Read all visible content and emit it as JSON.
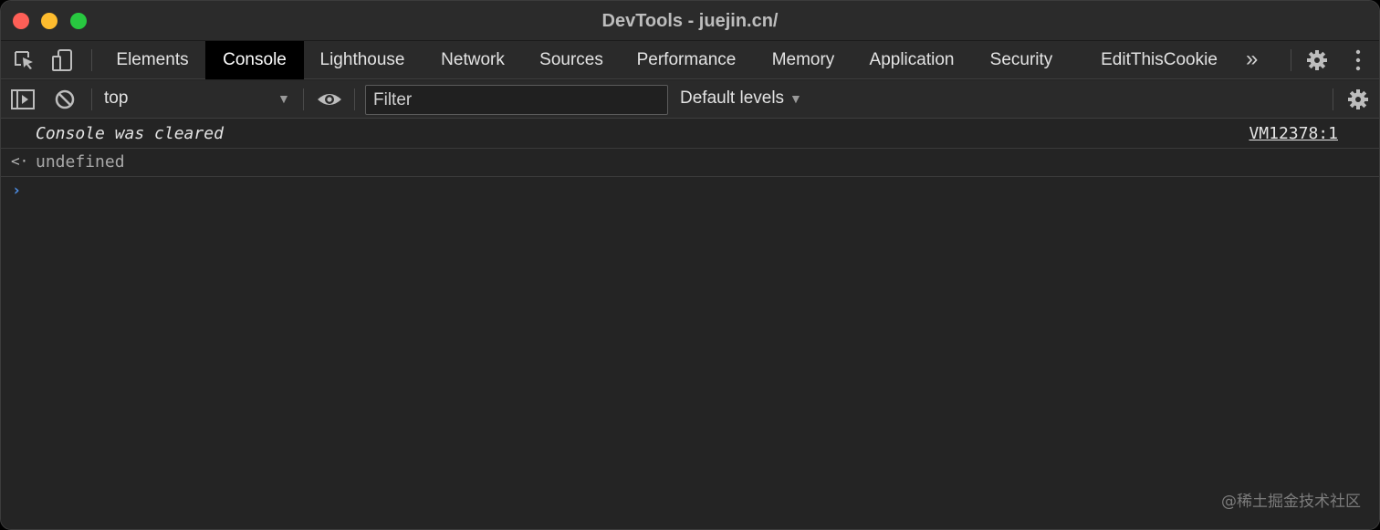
{
  "window": {
    "title": "DevTools - juejin.cn/"
  },
  "tabs": [
    {
      "label": "Elements"
    },
    {
      "label": "Console",
      "active": true
    },
    {
      "label": "Lighthouse"
    },
    {
      "label": "Network"
    },
    {
      "label": "Sources"
    },
    {
      "label": "Performance"
    },
    {
      "label": "Memory"
    },
    {
      "label": "Application"
    },
    {
      "label": "Security"
    },
    {
      "label": "EditThisCookie"
    }
  ],
  "tabbar": {
    "more_label": "»",
    "icons": [
      "inspect-element-icon",
      "device-toggle-icon",
      "settings-gear-icon",
      "kebab-menu-icon"
    ]
  },
  "toolbar": {
    "context": "top",
    "filter_placeholder": "Filter",
    "levels_label": "Default levels",
    "icons": [
      "sidebar-toggle-icon",
      "clear-console-icon",
      "live-expression-eye-icon",
      "console-settings-icon"
    ]
  },
  "console": {
    "cleared_message": "Console was cleared",
    "cleared_source": "VM12378:1",
    "return_arrow": "<·",
    "return_value": "undefined",
    "prompt": "›"
  },
  "watermark": "@稀土掘金技术社区",
  "colors": {
    "background": "#242424",
    "active_tab": "#000000",
    "prompt": "#4d8de3"
  }
}
